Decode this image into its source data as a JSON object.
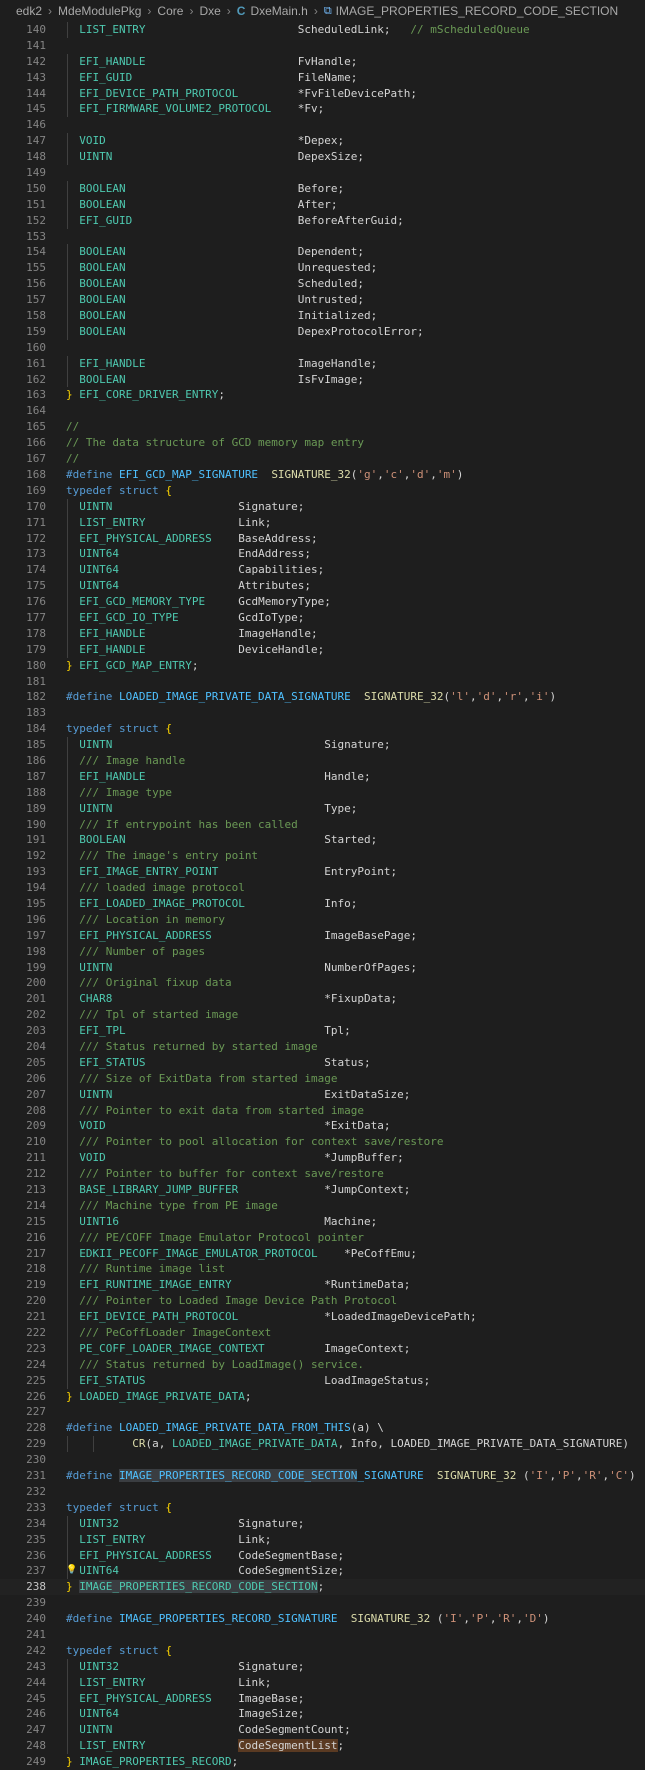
{
  "breadcrumb": [
    "edk2",
    "MdeModulePkg",
    "Core",
    "Dxe",
    "DxeMain.h",
    "IMAGE_PROPERTIES_RECORD_CODE_SECTION"
  ],
  "icons": {
    "file": "c-file-icon",
    "symbol": "struct-symbol-icon",
    "bulb": "lightbulb-icon"
  },
  "lines": [
    {
      "n": 140,
      "t": "  LIST_ENTRY                       ScheduledLink;   // mScheduledQueue"
    },
    {
      "n": 141,
      "t": ""
    },
    {
      "n": 142,
      "t": "  EFI_HANDLE                       FvHandle;"
    },
    {
      "n": 143,
      "t": "  EFI_GUID                         FileName;"
    },
    {
      "n": 144,
      "t": "  EFI_DEVICE_PATH_PROTOCOL         *FvFileDevicePath;"
    },
    {
      "n": 145,
      "t": "  EFI_FIRMWARE_VOLUME2_PROTOCOL    *Fv;"
    },
    {
      "n": 146,
      "t": ""
    },
    {
      "n": 147,
      "t": "  VOID                             *Depex;"
    },
    {
      "n": 148,
      "t": "  UINTN                            DepexSize;"
    },
    {
      "n": 149,
      "t": ""
    },
    {
      "n": 150,
      "t": "  BOOLEAN                          Before;"
    },
    {
      "n": 151,
      "t": "  BOOLEAN                          After;"
    },
    {
      "n": 152,
      "t": "  EFI_GUID                         BeforeAfterGuid;"
    },
    {
      "n": 153,
      "t": ""
    },
    {
      "n": 154,
      "t": "  BOOLEAN                          Dependent;"
    },
    {
      "n": 155,
      "t": "  BOOLEAN                          Unrequested;"
    },
    {
      "n": 156,
      "t": "  BOOLEAN                          Scheduled;"
    },
    {
      "n": 157,
      "t": "  BOOLEAN                          Untrusted;"
    },
    {
      "n": 158,
      "t": "  BOOLEAN                          Initialized;"
    },
    {
      "n": 159,
      "t": "  BOOLEAN                          DepexProtocolError;"
    },
    {
      "n": 160,
      "t": ""
    },
    {
      "n": 161,
      "t": "  EFI_HANDLE                       ImageHandle;"
    },
    {
      "n": 162,
      "t": "  BOOLEAN                          IsFvImage;"
    },
    {
      "n": 163,
      "t": "} EFI_CORE_DRIVER_ENTRY;"
    },
    {
      "n": 164,
      "t": ""
    },
    {
      "n": 165,
      "t": "//"
    },
    {
      "n": 166,
      "t": "// The data structure of GCD memory map entry"
    },
    {
      "n": 167,
      "t": "//"
    },
    {
      "n": 168,
      "t": "#define EFI_GCD_MAP_SIGNATURE  SIGNATURE_32('g','c','d','m')"
    },
    {
      "n": 169,
      "t": "typedef struct {"
    },
    {
      "n": 170,
      "t": "  UINTN                   Signature;"
    },
    {
      "n": 171,
      "t": "  LIST_ENTRY              Link;"
    },
    {
      "n": 172,
      "t": "  EFI_PHYSICAL_ADDRESS    BaseAddress;"
    },
    {
      "n": 173,
      "t": "  UINT64                  EndAddress;"
    },
    {
      "n": 174,
      "t": "  UINT64                  Capabilities;"
    },
    {
      "n": 175,
      "t": "  UINT64                  Attributes;"
    },
    {
      "n": 176,
      "t": "  EFI_GCD_MEMORY_TYPE     GcdMemoryType;"
    },
    {
      "n": 177,
      "t": "  EFI_GCD_IO_TYPE         GcdIoType;"
    },
    {
      "n": 178,
      "t": "  EFI_HANDLE              ImageHandle;"
    },
    {
      "n": 179,
      "t": "  EFI_HANDLE              DeviceHandle;"
    },
    {
      "n": 180,
      "t": "} EFI_GCD_MAP_ENTRY;"
    },
    {
      "n": 181,
      "t": ""
    },
    {
      "n": 182,
      "t": "#define LOADED_IMAGE_PRIVATE_DATA_SIGNATURE  SIGNATURE_32('l','d','r','i')"
    },
    {
      "n": 183,
      "t": ""
    },
    {
      "n": 184,
      "t": "typedef struct {"
    },
    {
      "n": 185,
      "t": "  UINTN                                Signature;"
    },
    {
      "n": 186,
      "t": "  /// Image handle"
    },
    {
      "n": 187,
      "t": "  EFI_HANDLE                           Handle;"
    },
    {
      "n": 188,
      "t": "  /// Image type"
    },
    {
      "n": 189,
      "t": "  UINTN                                Type;"
    },
    {
      "n": 190,
      "t": "  /// If entrypoint has been called"
    },
    {
      "n": 191,
      "t": "  BOOLEAN                              Started;"
    },
    {
      "n": 192,
      "t": "  /// The image's entry point"
    },
    {
      "n": 193,
      "t": "  EFI_IMAGE_ENTRY_POINT                EntryPoint;"
    },
    {
      "n": 194,
      "t": "  /// loaded image protocol"
    },
    {
      "n": 195,
      "t": "  EFI_LOADED_IMAGE_PROTOCOL            Info;"
    },
    {
      "n": 196,
      "t": "  /// Location in memory"
    },
    {
      "n": 197,
      "t": "  EFI_PHYSICAL_ADDRESS                 ImageBasePage;"
    },
    {
      "n": 198,
      "t": "  /// Number of pages"
    },
    {
      "n": 199,
      "t": "  UINTN                                NumberOfPages;"
    },
    {
      "n": 200,
      "t": "  /// Original fixup data"
    },
    {
      "n": 201,
      "t": "  CHAR8                                *FixupData;"
    },
    {
      "n": 202,
      "t": "  /// Tpl of started image"
    },
    {
      "n": 203,
      "t": "  EFI_TPL                              Tpl;"
    },
    {
      "n": 204,
      "t": "  /// Status returned by started image"
    },
    {
      "n": 205,
      "t": "  EFI_STATUS                           Status;"
    },
    {
      "n": 206,
      "t": "  /// Size of ExitData from started image"
    },
    {
      "n": 207,
      "t": "  UINTN                                ExitDataSize;"
    },
    {
      "n": 208,
      "t": "  /// Pointer to exit data from started image"
    },
    {
      "n": 209,
      "t": "  VOID                                 *ExitData;"
    },
    {
      "n": 210,
      "t": "  /// Pointer to pool allocation for context save/restore"
    },
    {
      "n": 211,
      "t": "  VOID                                 *JumpBuffer;"
    },
    {
      "n": 212,
      "t": "  /// Pointer to buffer for context save/restore"
    },
    {
      "n": 213,
      "t": "  BASE_LIBRARY_JUMP_BUFFER             *JumpContext;"
    },
    {
      "n": 214,
      "t": "  /// Machine type from PE image"
    },
    {
      "n": 215,
      "t": "  UINT16                               Machine;"
    },
    {
      "n": 216,
      "t": "  /// PE/COFF Image Emulator Protocol pointer"
    },
    {
      "n": 217,
      "t": "  EDKII_PECOFF_IMAGE_EMULATOR_PROTOCOL    *PeCoffEmu;"
    },
    {
      "n": 218,
      "t": "  /// Runtime image list"
    },
    {
      "n": 219,
      "t": "  EFI_RUNTIME_IMAGE_ENTRY              *RuntimeData;"
    },
    {
      "n": 220,
      "t": "  /// Pointer to Loaded Image Device Path Protocol"
    },
    {
      "n": 221,
      "t": "  EFI_DEVICE_PATH_PROTOCOL             *LoadedImageDevicePath;"
    },
    {
      "n": 222,
      "t": "  /// PeCoffLoader ImageContext"
    },
    {
      "n": 223,
      "t": "  PE_COFF_LOADER_IMAGE_CONTEXT         ImageContext;"
    },
    {
      "n": 224,
      "t": "  /// Status returned by LoadImage() service."
    },
    {
      "n": 225,
      "t": "  EFI_STATUS                           LoadImageStatus;"
    },
    {
      "n": 226,
      "t": "} LOADED_IMAGE_PRIVATE_DATA;"
    },
    {
      "n": 227,
      "t": ""
    },
    {
      "n": 228,
      "t": "#define LOADED_IMAGE_PRIVATE_DATA_FROM_THIS(a) \\"
    },
    {
      "n": 229,
      "t": "          CR(a, LOADED_IMAGE_PRIVATE_DATA, Info, LOADED_IMAGE_PRIVATE_DATA_SIGNATURE)"
    },
    {
      "n": 230,
      "t": ""
    },
    {
      "n": 231,
      "t": "#define IMAGE_PROPERTIES_RECORD_CODE_SECTION_SIGNATURE  SIGNATURE_32 ('I','P','R','C')"
    },
    {
      "n": 232,
      "t": ""
    },
    {
      "n": 233,
      "t": "typedef struct {"
    },
    {
      "n": 234,
      "t": "  UINT32                  Signature;"
    },
    {
      "n": 235,
      "t": "  LIST_ENTRY              Link;"
    },
    {
      "n": 236,
      "t": "  EFI_PHYSICAL_ADDRESS    CodeSegmentBase;"
    },
    {
      "n": 237,
      "t": "  UINT64                  CodeSegmentSize;"
    },
    {
      "n": 238,
      "t": "} IMAGE_PROPERTIES_RECORD_CODE_SECTION;"
    },
    {
      "n": 239,
      "t": ""
    },
    {
      "n": 240,
      "t": "#define IMAGE_PROPERTIES_RECORD_SIGNATURE  SIGNATURE_32 ('I','P','R','D')"
    },
    {
      "n": 241,
      "t": ""
    },
    {
      "n": 242,
      "t": "typedef struct {"
    },
    {
      "n": 243,
      "t": "  UINT32                  Signature;"
    },
    {
      "n": 244,
      "t": "  LIST_ENTRY              Link;"
    },
    {
      "n": 245,
      "t": "  EFI_PHYSICAL_ADDRESS    ImageBase;"
    },
    {
      "n": 246,
      "t": "  UINT64                  ImageSize;"
    },
    {
      "n": 247,
      "t": "  UINTN                   CodeSegmentCount;"
    },
    {
      "n": 248,
      "t": "  LIST_ENTRY              CodeSegmentList;"
    },
    {
      "n": 249,
      "t": "} IMAGE_PROPERTIES_RECORD;"
    }
  ],
  "current_line": 238,
  "colors": {
    "background": "#1e1e1e",
    "keyword": "#569cd6",
    "type": "#4ec9b0",
    "comment": "#6a9955",
    "string": "#ce9178",
    "bracket": "#ffd700"
  }
}
